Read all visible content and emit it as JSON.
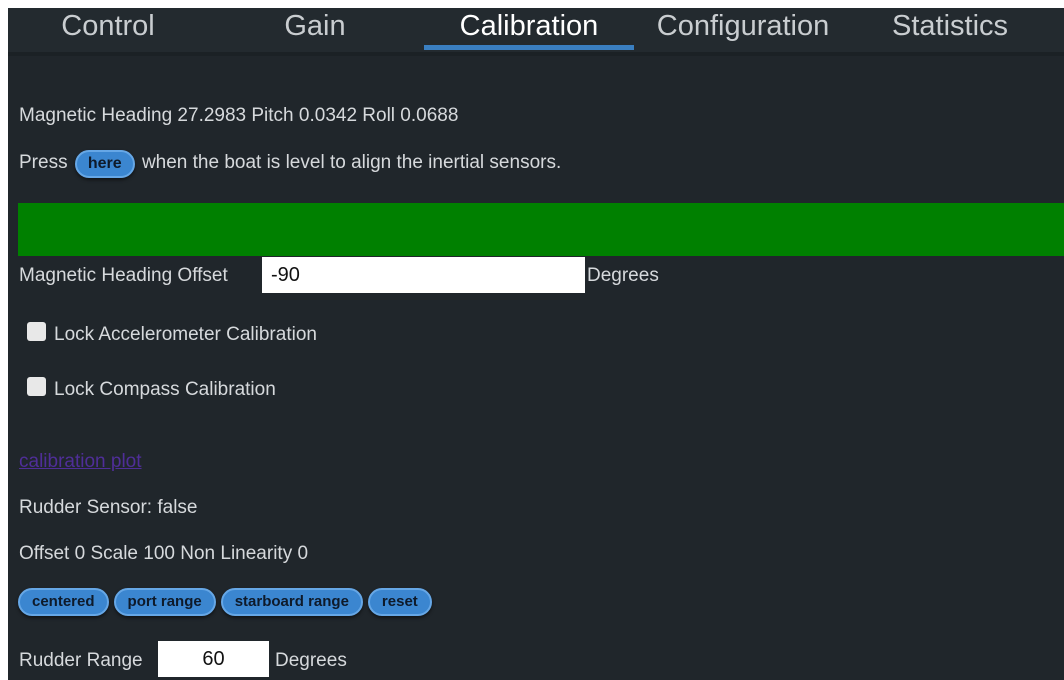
{
  "tabs": [
    {
      "label": "Control"
    },
    {
      "label": "Gain"
    },
    {
      "label": "Calibration"
    },
    {
      "label": "Configuration"
    },
    {
      "label": "Statistics"
    }
  ],
  "heading_line": "Magnetic Heading 27.2983 Pitch 0.0342 Roll 0.0688",
  "level": {
    "prefix": "Press",
    "button_label": "here",
    "suffix": "when the boat is level to align the inertial sensors."
  },
  "status_bar_color": "#008000",
  "heading_offset": {
    "label": "Magnetic Heading Offset",
    "value": "-90",
    "unit": "Degrees"
  },
  "lock_accel": {
    "label": "Lock Accelerometer Calibration",
    "checked": false
  },
  "lock_compass": {
    "label": "Lock Compass Calibration",
    "checked": false
  },
  "calibration_plot_link": "calibration plot",
  "rudder_sensor": "Rudder Sensor: false",
  "rudder_calibration": "Offset 0 Scale 100 Non Linearity 0",
  "rudder_buttons": [
    {
      "label": "centered"
    },
    {
      "label": "port range"
    },
    {
      "label": "starboard range"
    },
    {
      "label": "reset"
    }
  ],
  "rudder_range": {
    "label": "Rudder Range",
    "value": "60",
    "unit": "Degrees"
  },
  "colors": {
    "background": "#20262b",
    "accent": "#3b86d0",
    "link": "#4f2e98"
  }
}
